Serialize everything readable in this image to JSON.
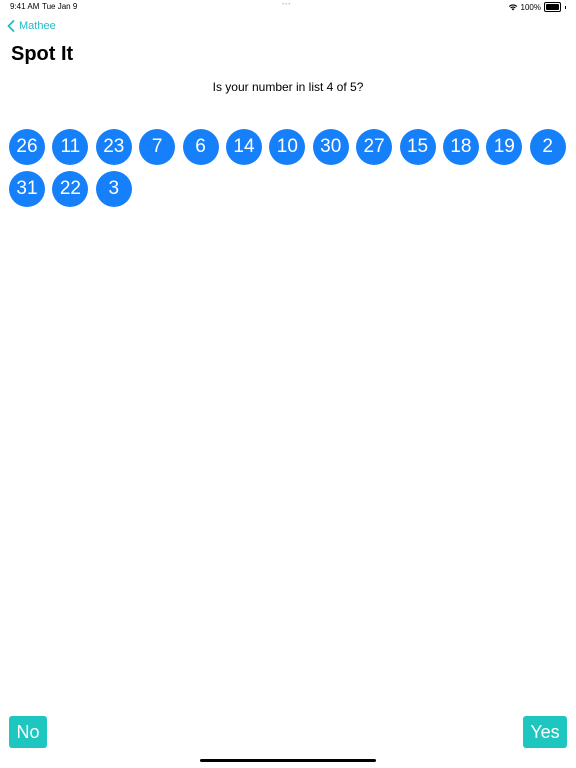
{
  "status_bar": {
    "time": "9:41 AM",
    "date": "Tue Jan 9",
    "battery": "100%",
    "battery_level": 1.0,
    "wifi_icon": "wifi-icon",
    "battery_icon": "battery-icon"
  },
  "nav": {
    "back_label": "Mathee",
    "back_icon": "chevron-left-icon",
    "accent_color": "#1fbcc9"
  },
  "page": {
    "title": "Spot It",
    "question": "Is your number in list 4 of 5?"
  },
  "numbers": [
    "26",
    "11",
    "23",
    "7",
    "6",
    "14",
    "10",
    "30",
    "27",
    "15",
    "18",
    "19",
    "2",
    "31",
    "22",
    "3"
  ],
  "colors": {
    "bubble": "#1580f9",
    "button": "#1ec6c0"
  },
  "actions": {
    "no_label": "No",
    "yes_label": "Yes"
  }
}
